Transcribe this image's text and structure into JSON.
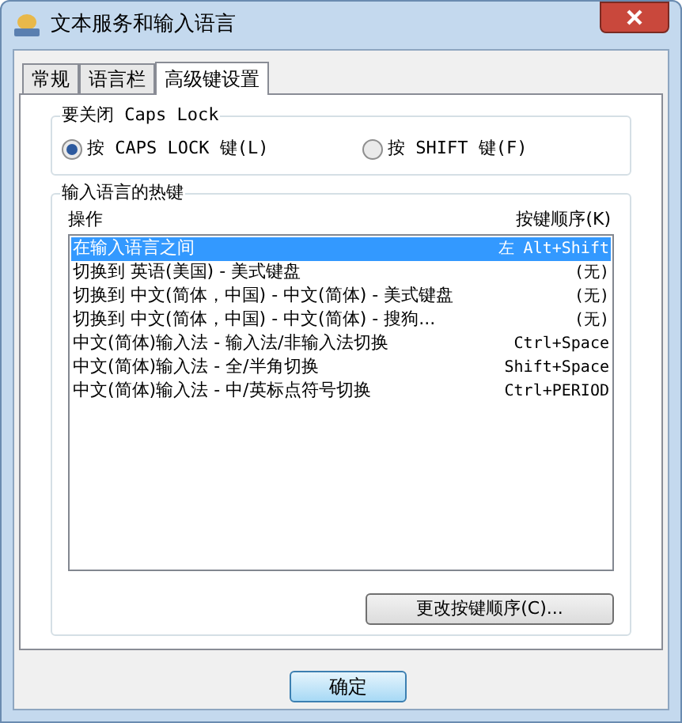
{
  "window": {
    "title": "文本服务和输入语言"
  },
  "tabs": [
    {
      "label": "常规",
      "selected": false
    },
    {
      "label": "语言栏",
      "selected": false
    },
    {
      "label": "高级键设置",
      "selected": true
    }
  ],
  "caps_lock_group": {
    "title": "要关闭 Caps Lock",
    "options": [
      {
        "label": "按 CAPS LOCK 键(L)",
        "selected": true
      },
      {
        "label": "按 SHIFT 键(F)",
        "selected": false
      }
    ]
  },
  "hotkeys_group": {
    "title": "输入语言的热键",
    "columns": [
      "操作",
      "按键顺序(K)"
    ],
    "rows": [
      {
        "action": "在输入语言之间",
        "keys": "左 Alt+Shift",
        "selected": true
      },
      {
        "action": "切换到 英语(美国) - 美式键盘",
        "keys": "(无)",
        "selected": false
      },
      {
        "action": "切换到 中文(简体，中国) - 中文(简体) - 美式键盘",
        "keys": "(无)",
        "selected": false
      },
      {
        "action": "切换到 中文(简体，中国) - 中文(简体) - 搜狗...",
        "keys": "(无)",
        "selected": false
      },
      {
        "action": "中文(简体)输入法 - 输入法/非输入法切换",
        "keys": "Ctrl+Space",
        "selected": false
      },
      {
        "action": "中文(简体)输入法 - 全/半角切换",
        "keys": "Shift+Space",
        "selected": false
      },
      {
        "action": "中文(简体)输入法 - 中/英标点符号切换",
        "keys": "Ctrl+PERIOD",
        "selected": false
      }
    ],
    "change_button": "更改按键顺序(C)..."
  },
  "buttons": [
    "确定"
  ]
}
